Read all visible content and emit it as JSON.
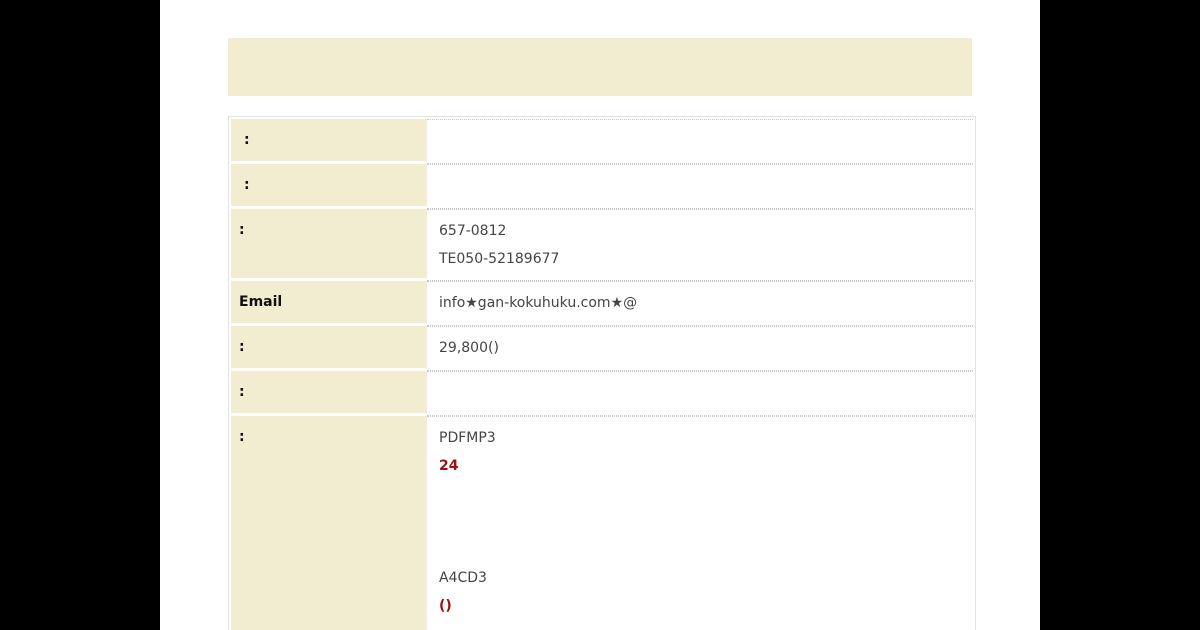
{
  "rows": [
    {
      "label": " :",
      "lines": []
    },
    {
      "label": " :",
      "lines": []
    },
    {
      "label": ":",
      "lines": [
        "657-0812",
        "TE050-52189677"
      ]
    },
    {
      "label": "Email",
      "lines": [
        "info★gan-kokuhuku.com★@"
      ]
    },
    {
      "label": ":",
      "lines": [
        "29,800()"
      ]
    },
    {
      "label": ":",
      "lines": []
    },
    {
      "label": ":",
      "lines": [
        "PDFMP3",
        "24",
        "A4CD3",
        "()",
        "→"
      ]
    }
  ]
}
